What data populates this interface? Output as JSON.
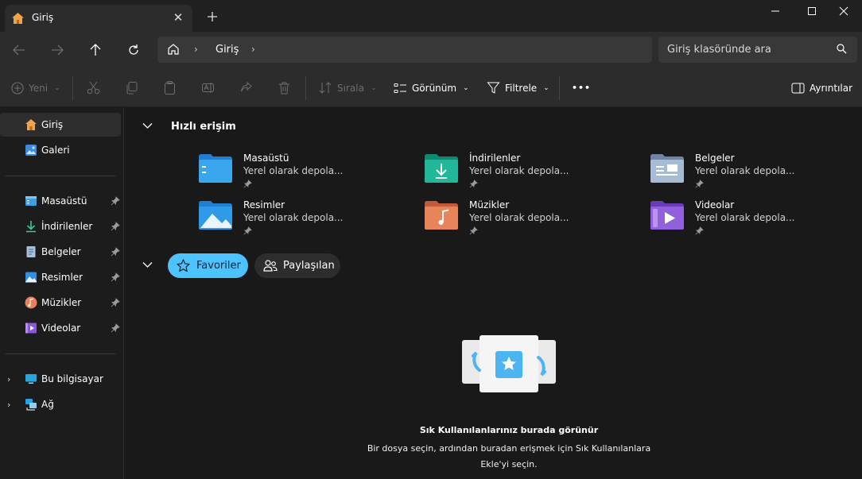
{
  "window": {
    "tab_title": "Giriş",
    "controls": [
      "minimize",
      "maximize",
      "close"
    ]
  },
  "address": {
    "breadcrumb": "Giriş",
    "search_placeholder": "Giriş klasöründe ara"
  },
  "commands": {
    "new": "Yeni",
    "sort": "Sırala",
    "view": "Görünüm",
    "filter": "Filtrele",
    "more": "•••",
    "details": "Ayrıntılar"
  },
  "sidebar": {
    "top": [
      {
        "label": "Giriş",
        "icon": "home-icon",
        "selected": true
      },
      {
        "label": "Galeri",
        "icon": "gallery-icon"
      }
    ],
    "pinned": [
      {
        "label": "Masaüstü",
        "icon": "desktop-folder-icon"
      },
      {
        "label": "İndirilenler",
        "icon": "downloads-icon"
      },
      {
        "label": "Belgeler",
        "icon": "documents-icon"
      },
      {
        "label": "Resimler",
        "icon": "pictures-icon"
      },
      {
        "label": "Müzikler",
        "icon": "music-icon"
      },
      {
        "label": "Videolar",
        "icon": "videos-icon"
      }
    ],
    "bottom": [
      {
        "label": "Bu bilgisayar",
        "icon": "this-pc-icon"
      },
      {
        "label": "Ağ",
        "icon": "network-icon"
      }
    ]
  },
  "quick_access": {
    "title": "Hızlı erişim",
    "items": [
      {
        "name": "Masaüstü",
        "sub": "Yerel olarak depola...",
        "icon": "desktop-folder-icon"
      },
      {
        "name": "İndirilenler",
        "sub": "Yerel olarak depola...",
        "icon": "downloads-folder-icon"
      },
      {
        "name": "Belgeler",
        "sub": "Yerel olarak depola...",
        "icon": "documents-folder-icon"
      },
      {
        "name": "Resimler",
        "sub": "Yerel olarak depola...",
        "icon": "pictures-folder-icon"
      },
      {
        "name": "Müzikler",
        "sub": "Yerel olarak depola...",
        "icon": "music-folder-icon"
      },
      {
        "name": "Videolar",
        "sub": "Yerel olarak depola...",
        "icon": "videos-folder-icon"
      }
    ]
  },
  "favorites": {
    "tab_favorites": "Favoriler",
    "tab_shared": "Paylaşılan",
    "empty_title": "Sık Kullanılanlarınız burada görünür",
    "empty_desc": "Bir dosya seçin, ardından buradan erişmek için Sık Kullanılanlara Ekle'yi seçin."
  },
  "colors": {
    "accent": "#4cc2ff",
    "background": "#191919",
    "chrome": "#2c2c2c"
  }
}
